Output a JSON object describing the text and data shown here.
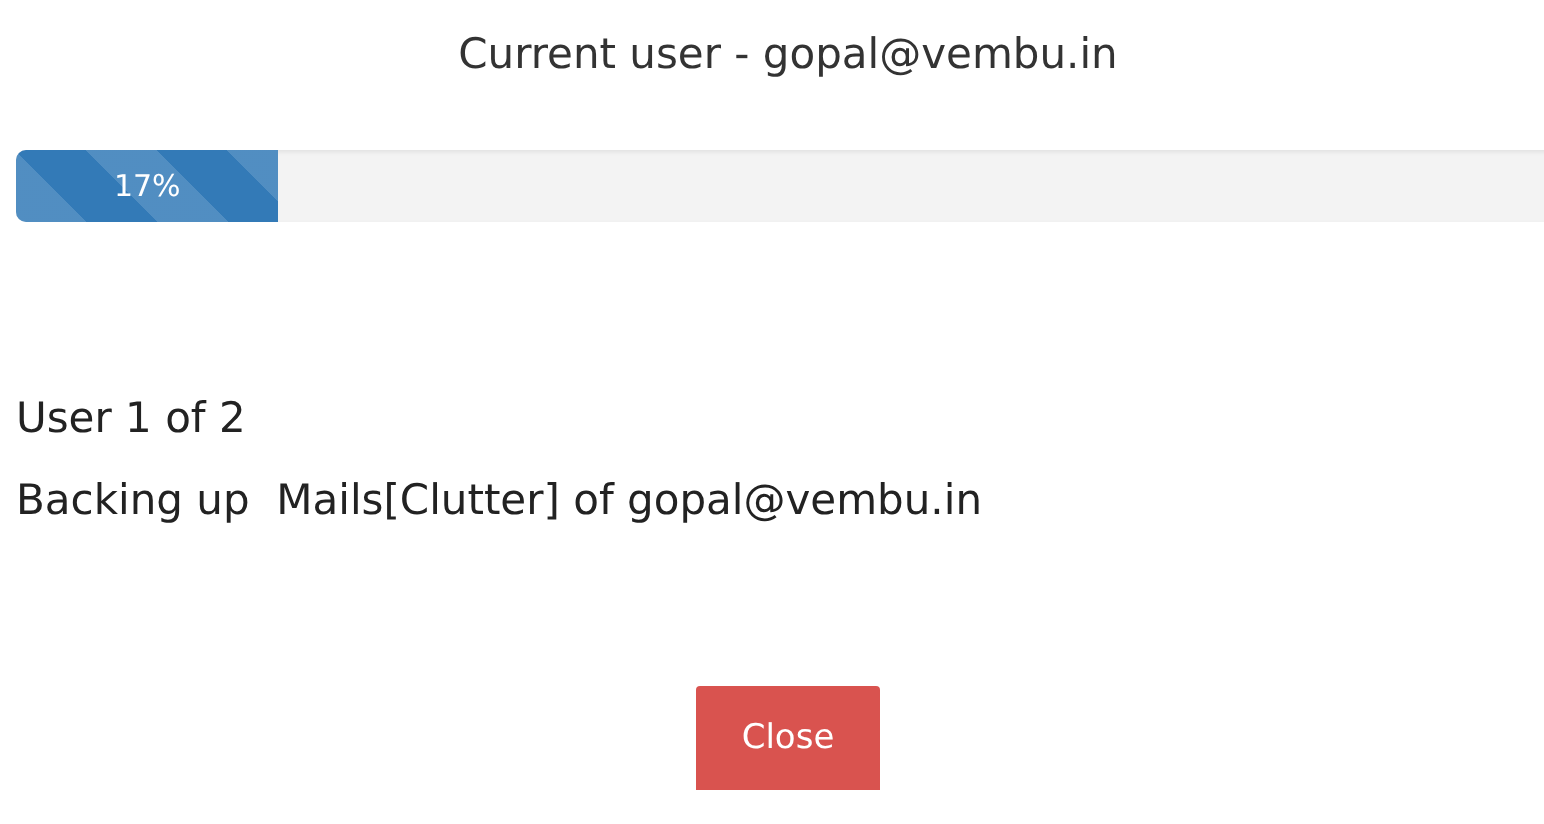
{
  "title": "Current user - gopal@vembu.in",
  "progress": {
    "level": 0.17,
    "reading": "17%"
  },
  "status_lines": [
    "User 1 of 2",
    "Backing up  Mails[Clutter] of gopal@vembu.in"
  ],
  "buttons": [
    "Close"
  ]
}
